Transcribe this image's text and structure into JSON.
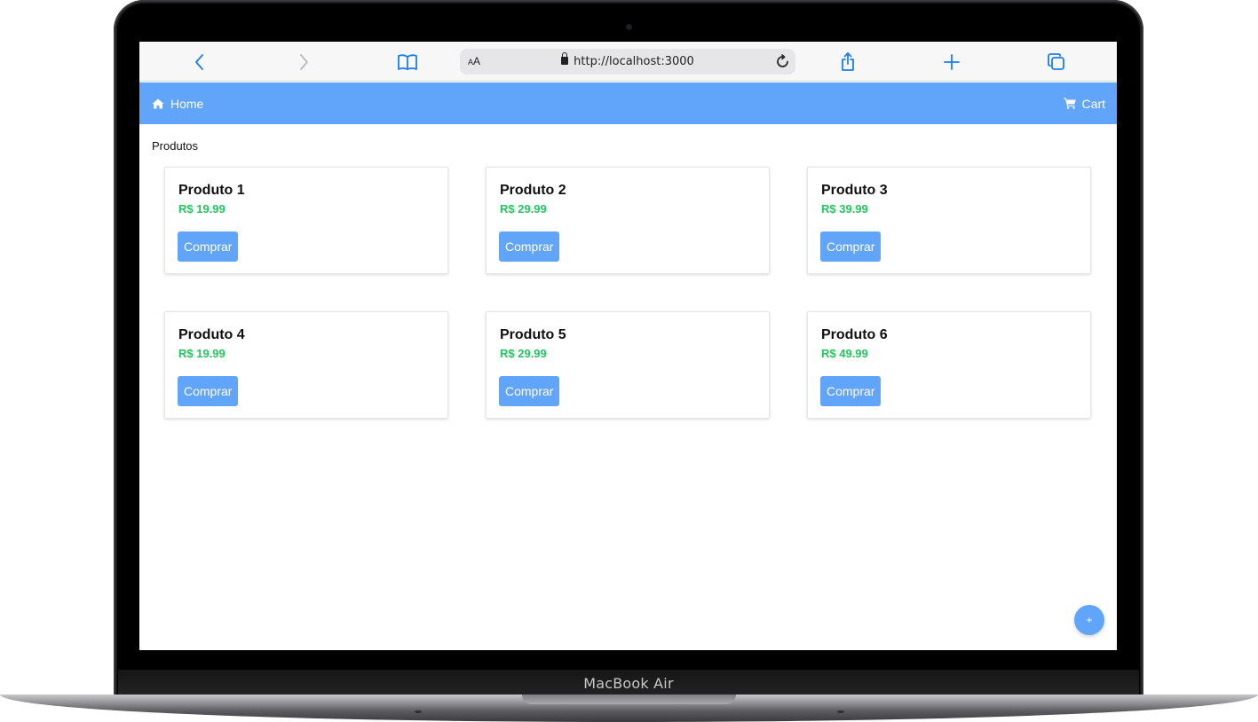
{
  "device": {
    "label": "MacBook Air"
  },
  "browser": {
    "address": {
      "text_size_label_small": "A",
      "text_size_label_large": "A",
      "url": "http://localhost:3000"
    },
    "icons": [
      "back-icon",
      "forward-icon",
      "bookmarks-icon",
      "lock-icon",
      "reload-icon",
      "share-icon",
      "new-tab-icon",
      "tabs-icon"
    ]
  },
  "navbar": {
    "home_label": "Home",
    "cart_label": "Cart",
    "color": "#60a5fa"
  },
  "main": {
    "section_title": "Produtos",
    "products": [
      {
        "name": "Produto 1",
        "price": "R$ 19.99",
        "button": "Comprar"
      },
      {
        "name": "Produto 2",
        "price": "R$ 29.99",
        "button": "Comprar"
      },
      {
        "name": "Produto 3",
        "price": "R$ 39.99",
        "button": "Comprar"
      },
      {
        "name": "Produto 4",
        "price": "R$ 19.99",
        "button": "Comprar"
      },
      {
        "name": "Produto 5",
        "price": "R$ 29.99",
        "button": "Comprar"
      },
      {
        "name": "Produto 6",
        "price": "R$ 49.99",
        "button": "Comprar"
      }
    ],
    "price_color": "#22c55e"
  },
  "fab": {
    "label": "+"
  }
}
